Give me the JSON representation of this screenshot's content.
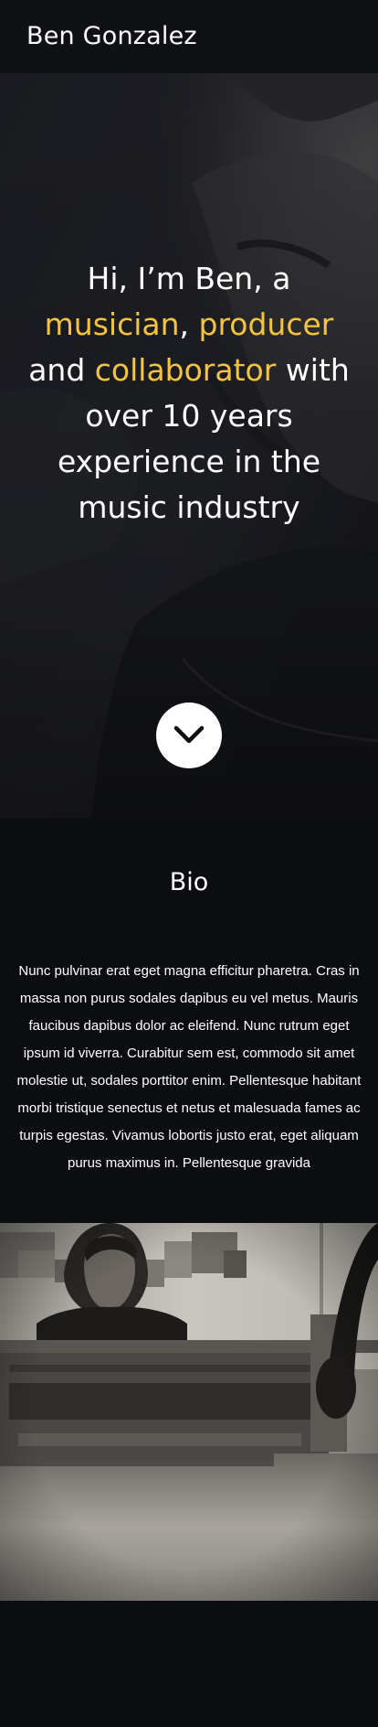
{
  "header": {
    "site_title": "Ben Gonzalez"
  },
  "hero": {
    "intro_prefix": "Hi, I’m Ben, a",
    "role_1": "musician",
    "separator_1": ", ",
    "role_2": "producer",
    "connector": "and",
    "role_3": "collaborator",
    "suffix": "with over 10 years experience in the music industry",
    "highlight_color": "#f4c440",
    "scroll_icon": "chevron-down-icon"
  },
  "bio": {
    "title": "Bio",
    "text": "Nunc pulvinar erat eget magna efficitur pharetra. Cras in massa non purus sodales dapibus eu vel metus. Mauris faucibus dapibus dolor ac eleifend. Nunc rutrum eget ipsum id viverra. Curabitur sem est, commodo sit amet molestie ut, sodales porttitor enim. Pellentesque habitant morbi tristique senectus et netus et malesuada fames ac turpis egestas. Vivamus lobortis justo erat, eget aliquam purus maximus in. Pellentesque gravida"
  },
  "colors": {
    "background": "#0c0d11",
    "header_bg": "#101115",
    "accent": "#f4c440",
    "text": "#ffffff"
  }
}
